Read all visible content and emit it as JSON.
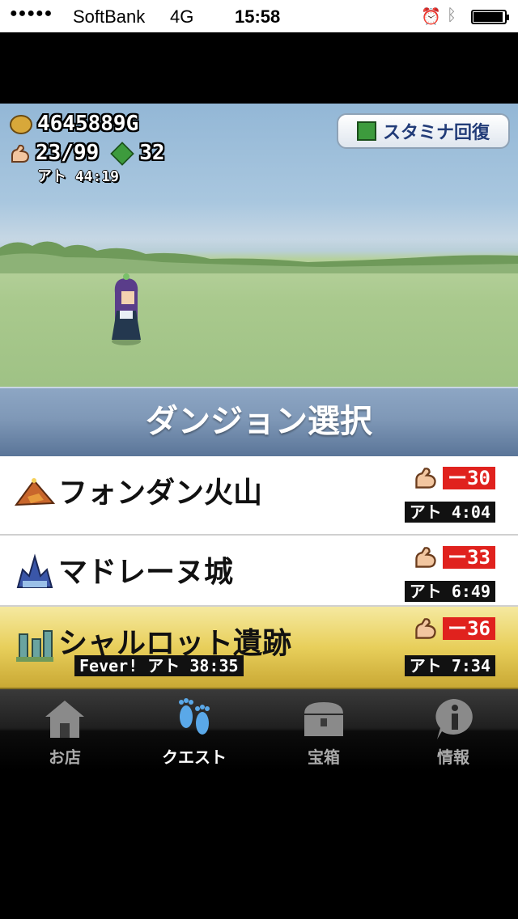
{
  "status_bar": {
    "signal_dots": "●●●●●",
    "carrier": "SoftBank",
    "network": "4G",
    "time": "15:58",
    "battery_level": 0.95
  },
  "hud": {
    "gold": "4645889G",
    "stamina": "23/99",
    "gems": "32",
    "stamina_timer": "アト 44:19",
    "stamina_recover_button": "スタミナ回復"
  },
  "title": "ダンジョン選択",
  "dungeons": [
    {
      "name": "フォンダン火山",
      "cost": "ー30",
      "timer": "アト 4:04",
      "icon": "volcano-icon",
      "fever": ""
    },
    {
      "name": "マドレーヌ城",
      "cost": "ー33",
      "timer": "アト 6:49",
      "icon": "castle-icon",
      "fever": ""
    },
    {
      "name": "シャルロット遺跡",
      "cost": "ー36",
      "timer": "アト 7:34",
      "icon": "ruins-icon",
      "fever": "Fever! アト 38:35"
    }
  ],
  "tabs": [
    {
      "label": "お店",
      "icon": "shop-icon"
    },
    {
      "label": "クエスト",
      "icon": "footprints-icon"
    },
    {
      "label": "宝箱",
      "icon": "treasure-chest-icon"
    },
    {
      "label": "情報",
      "icon": "info-icon"
    }
  ],
  "selected_tab": "クエスト",
  "colors": {
    "title_bar": "#7f98b7",
    "active_row": "#e8cf5b",
    "cost_red": "#e0221e",
    "accent_blue": "#223c78"
  }
}
